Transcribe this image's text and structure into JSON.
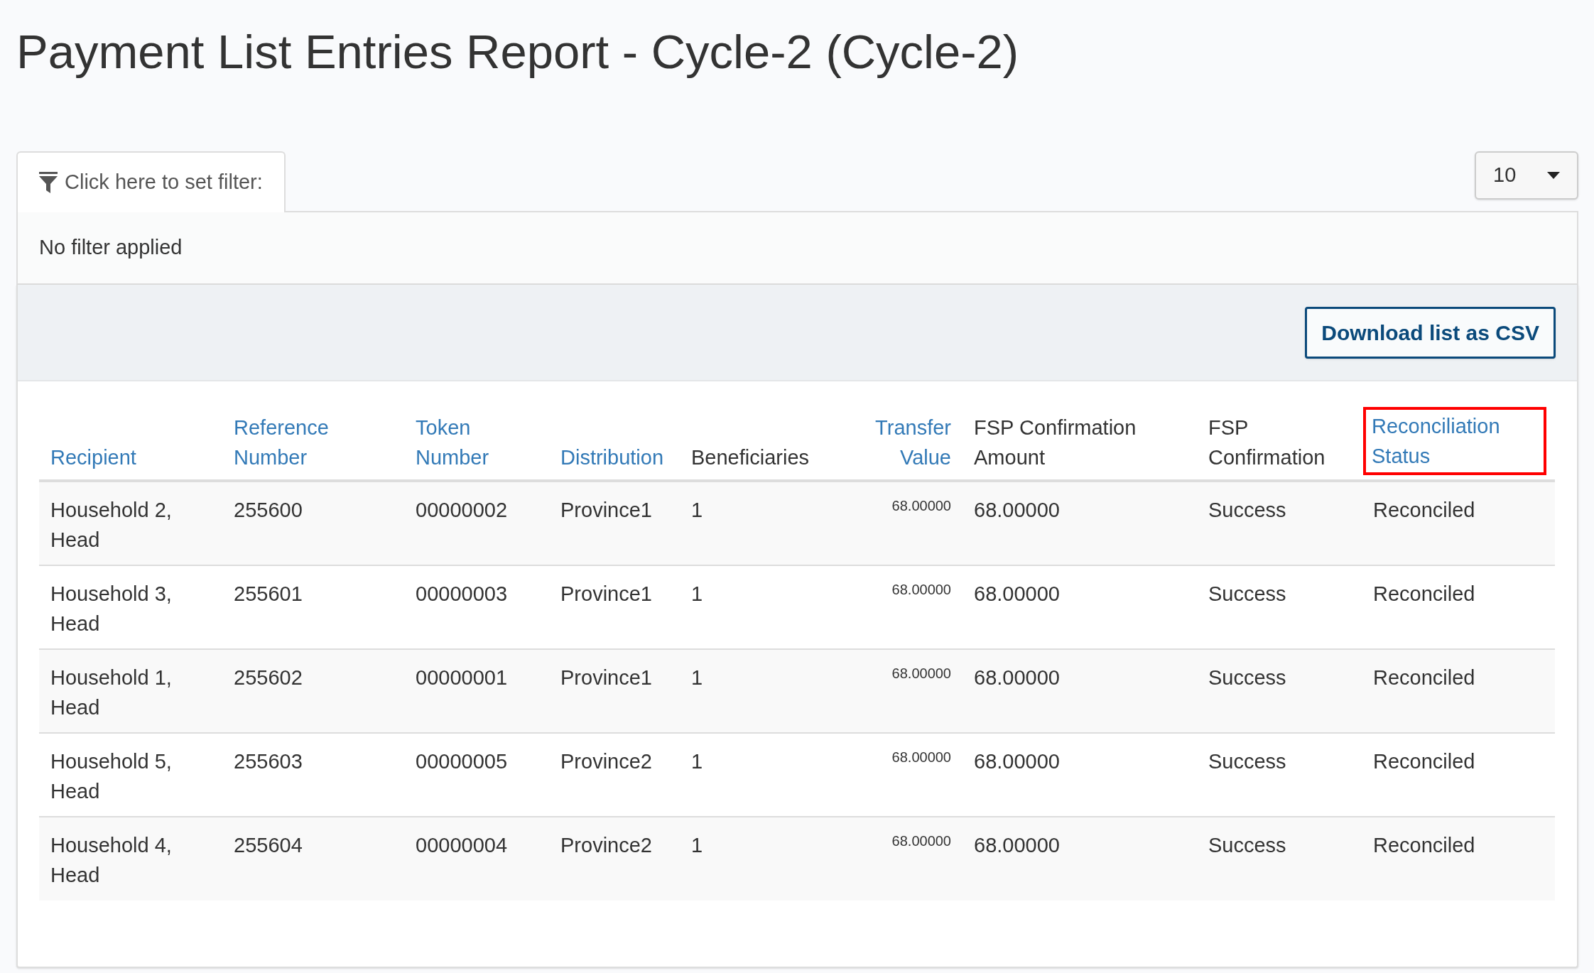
{
  "title": "Payment List Entries Report - Cycle-2 (Cycle-2)",
  "filter": {
    "tab_label": "Click here to set filter:",
    "status": "No filter applied"
  },
  "page_size": {
    "value": "10"
  },
  "download_button": "Download list as CSV",
  "table": {
    "columns": [
      {
        "label": "Recipient",
        "sortable": true,
        "kind": "text",
        "highlighted": false
      },
      {
        "label": "Reference Number",
        "sortable": true,
        "kind": "text",
        "highlighted": false
      },
      {
        "label": "Token Number",
        "sortable": true,
        "kind": "text",
        "highlighted": false
      },
      {
        "label": "Distribution",
        "sortable": true,
        "kind": "text",
        "highlighted": false
      },
      {
        "label": "Beneficiaries",
        "sortable": false,
        "kind": "text",
        "highlighted": false
      },
      {
        "label": "Transfer Value",
        "sortable": true,
        "kind": "amount",
        "highlighted": false
      },
      {
        "label": "FSP Confirmation Amount",
        "sortable": false,
        "kind": "text",
        "highlighted": false
      },
      {
        "label": "FSP Confirmation",
        "sortable": false,
        "kind": "text",
        "highlighted": false
      },
      {
        "label": "Reconciliation Status",
        "sortable": true,
        "kind": "text",
        "highlighted": true
      }
    ],
    "rows": [
      [
        "Household 2, Head",
        "255600",
        "00000002",
        "Province1",
        "1",
        "68.00000",
        "68.00000",
        "Success",
        "Reconciled"
      ],
      [
        "Household 3, Head",
        "255601",
        "00000003",
        "Province1",
        "1",
        "68.00000",
        "68.00000",
        "Success",
        "Reconciled"
      ],
      [
        "Household 1, Head",
        "255602",
        "00000001",
        "Province1",
        "1",
        "68.00000",
        "68.00000",
        "Success",
        "Reconciled"
      ],
      [
        "Household 5, Head",
        "255603",
        "00000005",
        "Province2",
        "1",
        "68.00000",
        "68.00000",
        "Success",
        "Reconciled"
      ],
      [
        "Household 4, Head",
        "255604",
        "00000004",
        "Province2",
        "1",
        "68.00000",
        "68.00000",
        "Success",
        "Reconciled"
      ]
    ]
  }
}
